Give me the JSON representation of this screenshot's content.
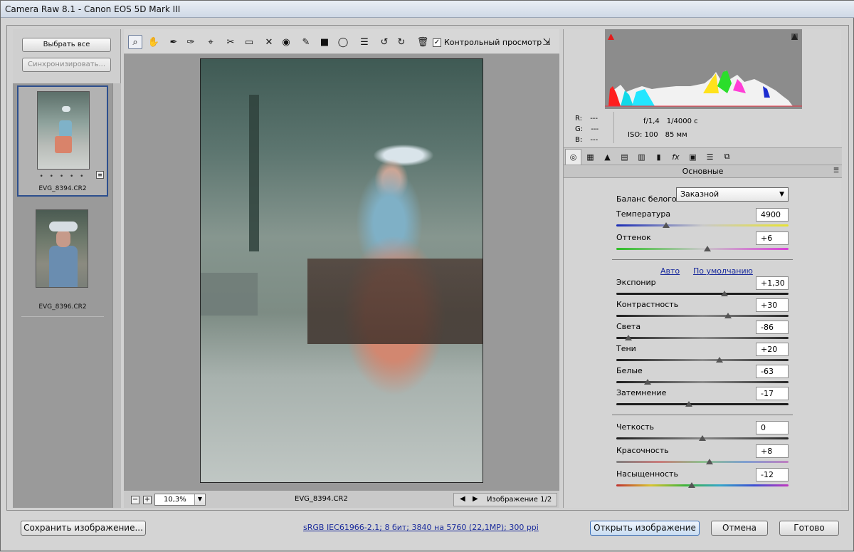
{
  "window": {
    "title": "Camera Raw 8.1  -  Canon EOS 5D Mark III"
  },
  "filmstrip": {
    "select_all": "Выбрать все",
    "synchronize": "Синхронизировать...",
    "items": [
      {
        "name": "EVG_8394.CR2",
        "rating": "• • • • •",
        "selected": true
      },
      {
        "name": "EVG_8396.CR2",
        "selected": false
      }
    ]
  },
  "toolbar": {
    "tools": [
      "zoom-icon",
      "hand-icon",
      "white-balance-icon",
      "color-sampler-icon",
      "targeted-adjustment-icon",
      "crop-icon",
      "straighten-icon",
      "spot-removal-icon",
      "red-eye-icon",
      "adjustment-brush-icon",
      "graduated-filter-icon",
      "radial-filter-icon",
      "preferences-icon",
      "rotate-left-icon",
      "rotate-right-icon",
      "trash-icon"
    ],
    "preview_label": "Контрольный просмотр",
    "preview_checked": true
  },
  "canvas": {
    "zoom": "10,3%",
    "filename": "EVG_8394.CR2",
    "image_counter": "Изображение 1/2"
  },
  "readout": {
    "r_label": "R:",
    "r_value": "---",
    "g_label": "G:",
    "g_value": "---",
    "b_label": "B:",
    "b_value": "---",
    "aperture": "f/1,4",
    "shutter": "1/4000 с",
    "iso": "ISO: 100",
    "focal": "85 мм"
  },
  "panel": {
    "title": "Основные",
    "wb_label": "Баланс белого:",
    "wb_value": "Заказной",
    "auto": "Авто",
    "default": "По умолчанию",
    "sliders": [
      {
        "label": "Температура",
        "value": "4900",
        "pos": 0.29
      },
      {
        "label": "Оттенок",
        "value": "+6",
        "pos": 0.53
      },
      {
        "label": "Экспонир",
        "value": "+1,30",
        "pos": 0.63
      },
      {
        "label": "Контрастность",
        "value": "+30",
        "pos": 0.65
      },
      {
        "label": "Света",
        "value": "-86",
        "pos": 0.07
      },
      {
        "label": "Тени",
        "value": "+20",
        "pos": 0.6
      },
      {
        "label": "Белые",
        "value": "-63",
        "pos": 0.18
      },
      {
        "label": "Затемнение",
        "value": "-17",
        "pos": 0.42
      },
      {
        "label": "Четкость",
        "value": "0",
        "pos": 0.5
      },
      {
        "label": "Красочность",
        "value": "+8",
        "pos": 0.54
      },
      {
        "label": "Насыщенность",
        "value": "-12",
        "pos": 0.44
      }
    ]
  },
  "footer": {
    "save": "Сохранить изображение...",
    "workflow": "sRGB IEC61966-2.1; 8 бит; 3840 на 5760 (22,1MP); 300 ppi",
    "open": "Открыть изображение",
    "cancel": "Отмена",
    "done": "Готово"
  }
}
